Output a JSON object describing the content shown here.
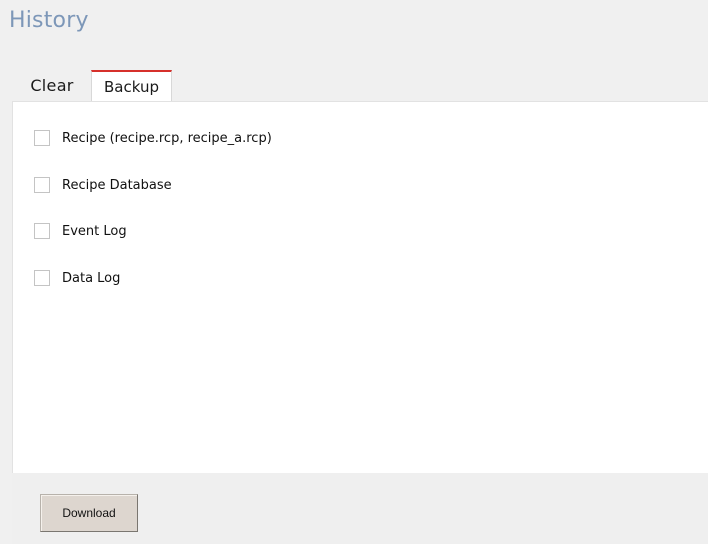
{
  "page": {
    "title": "History"
  },
  "tabs": [
    {
      "label": "Clear",
      "active": false
    },
    {
      "label": "Backup",
      "active": true
    }
  ],
  "options": [
    {
      "label": "Recipe (recipe.rcp, recipe_a.rcp)",
      "checked": false
    },
    {
      "label": "Recipe Database",
      "checked": false
    },
    {
      "label": "Event Log",
      "checked": false
    },
    {
      "label": "Data Log",
      "checked": false
    }
  ],
  "footer": {
    "download_label": "Download"
  },
  "colors": {
    "title": "#7d97b8",
    "active_tab_accent": "#d6302b",
    "panel_background": "#ffffff",
    "page_background": "#f0f0f0",
    "button_background": "#ddd6cf"
  }
}
